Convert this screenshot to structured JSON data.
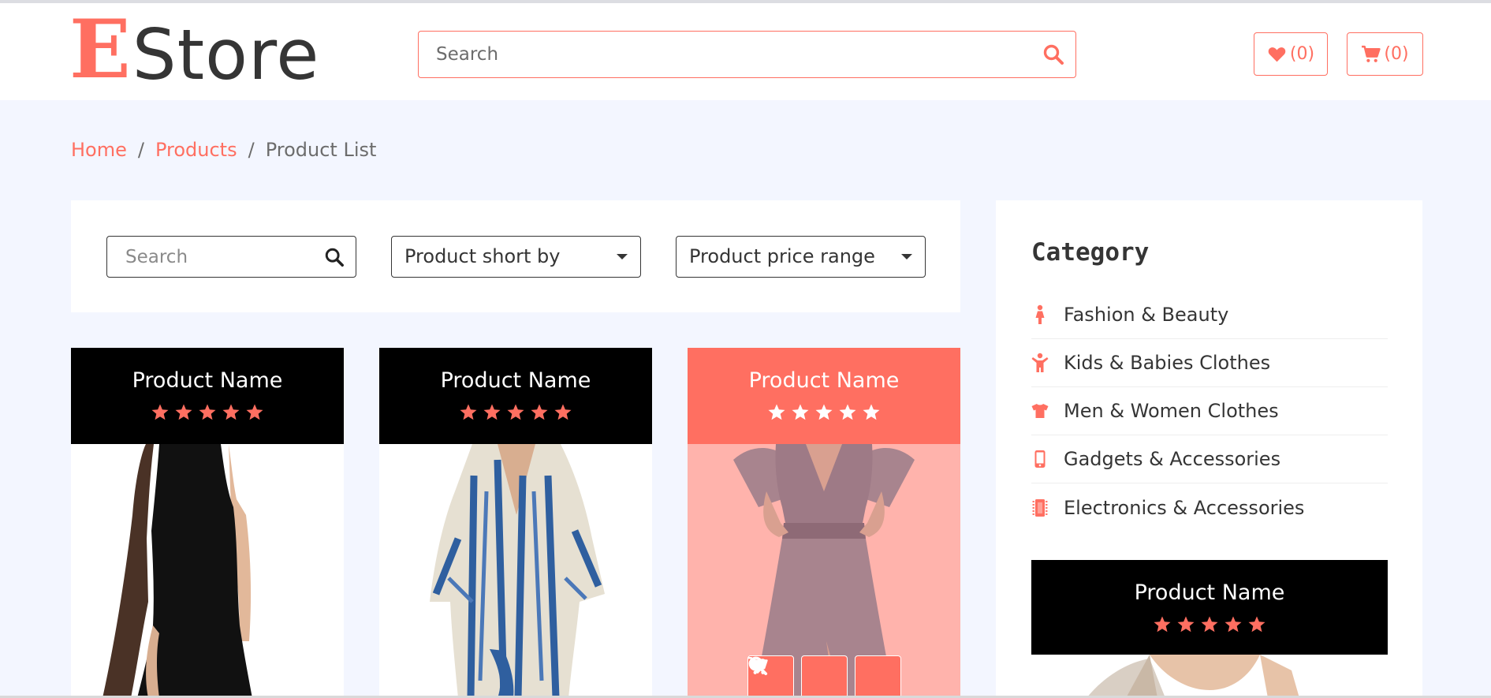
{
  "header": {
    "logo_first": "E",
    "logo_rest": "Store",
    "search_placeholder": "Search",
    "wishlist_count": "(0)",
    "cart_count": "(0)"
  },
  "breadcrumb": {
    "items": [
      "Home",
      "Products",
      "Product List"
    ],
    "separator": "/"
  },
  "filters": {
    "search_placeholder": "Search",
    "sort_label": "Product short by",
    "price_label": "Product price range"
  },
  "products": [
    {
      "name": "Product Name",
      "rating": 5,
      "image": "black tank dress"
    },
    {
      "name": "Product Name",
      "rating": 5,
      "image": "blue tie-dye kaftan"
    },
    {
      "name": "Product Name",
      "rating": 5,
      "image": "mauve cold-shoulder gown"
    }
  ],
  "sidebar": {
    "category_title": "Category",
    "categories": [
      {
        "label": "Fashion & Beauty",
        "icon": "female-icon"
      },
      {
        "label": "Kids & Babies Clothes",
        "icon": "child-icon"
      },
      {
        "label": "Men & Women Clothes",
        "icon": "tshirt-icon"
      },
      {
        "label": "Gadgets & Accessories",
        "icon": "mobile-icon"
      },
      {
        "label": "Electronics & Accessories",
        "icon": "microchip-icon"
      }
    ],
    "featured_product": {
      "name": "Product Name",
      "rating": 5
    }
  },
  "colors": {
    "accent": "#ff6f61",
    "dark": "#000000",
    "page_bg": "#f3f6ff"
  }
}
